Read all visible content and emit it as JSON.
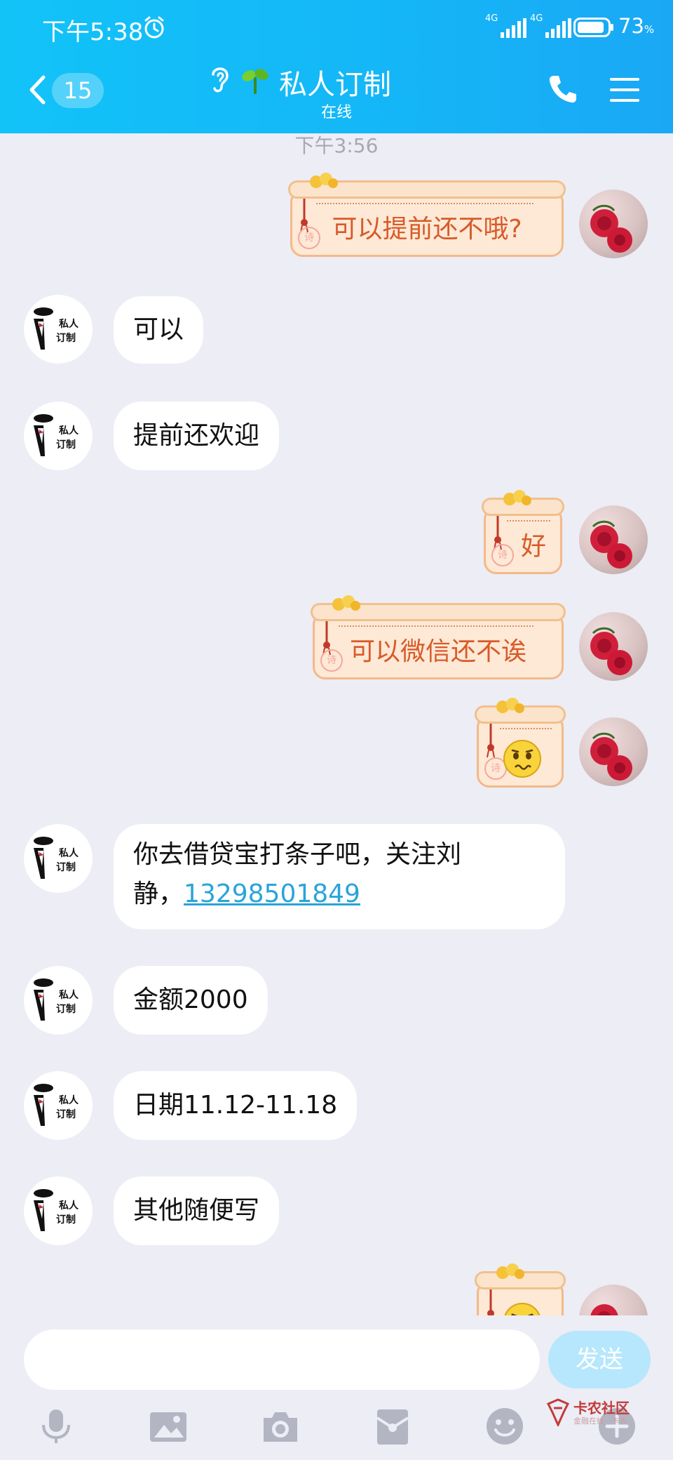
{
  "status_bar": {
    "time": "下午5:38",
    "signal_1_label": "4G",
    "signal_2_label": "4G",
    "battery_percent": "73",
    "battery_unit": "%"
  },
  "header": {
    "back_count": "15",
    "title": "私人订制",
    "subtitle": "在线"
  },
  "timestamp": "下午3:56",
  "messages": [
    {
      "side": "right",
      "style": "scroll",
      "text": "可以提前还不哦?"
    },
    {
      "side": "left",
      "text": "可以"
    },
    {
      "side": "left",
      "text": "提前还欢迎"
    },
    {
      "side": "right",
      "style": "scroll",
      "text": "好"
    },
    {
      "side": "right",
      "style": "scroll",
      "text": "可以微信还不诶"
    },
    {
      "side": "right",
      "style": "scroll",
      "emoji": "worried-face-emoji"
    },
    {
      "side": "left",
      "text_line1": "你去借贷宝打条子吧，关注刘",
      "text_line2_prefix": "静，",
      "phone_link": "13298501849"
    },
    {
      "side": "left",
      "text": "金额2000"
    },
    {
      "side": "left",
      "text": "日期11.12-11.18"
    },
    {
      "side": "left",
      "text": "其他随便写"
    },
    {
      "side": "right",
      "style": "scroll",
      "emoji": "angry-face-emoji"
    }
  ],
  "avatar_text": {
    "line1": "私人",
    "line2": "订制"
  },
  "input": {
    "placeholder": "",
    "send_label": "发送"
  },
  "toolbar_icons": [
    "microphone-icon",
    "image-icon",
    "camera-icon",
    "red-packet-icon",
    "emoji-icon",
    "plus-icon"
  ],
  "watermark": {
    "title": "卡农社区",
    "subtitle": "金融在线 · 卡农"
  },
  "colors": {
    "header_blue": "#14b7f7",
    "bubble_scroll_text": "#d85a2a",
    "link": "#2aa4d8",
    "send_button": "#b6e7fc"
  }
}
